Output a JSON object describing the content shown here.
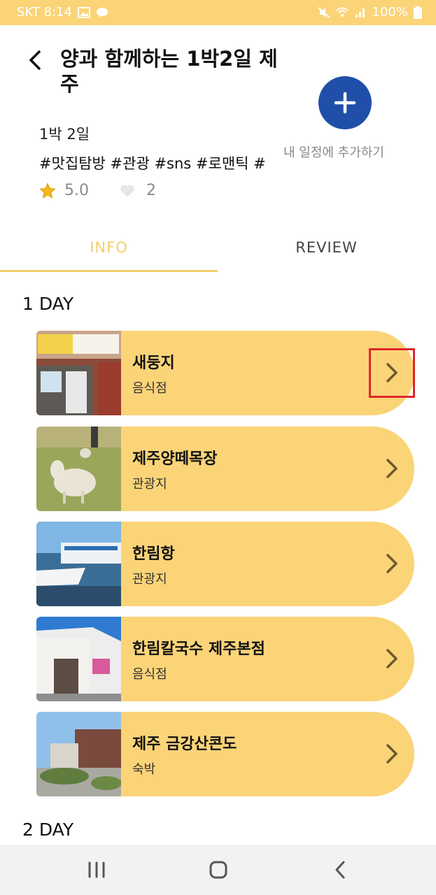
{
  "status_bar": {
    "carrier_time": "SKT 8:14",
    "battery": "100%"
  },
  "header": {
    "title": "양과 함께하는 1박2일 제주",
    "duration": "1박 2일",
    "tags": "#맛집탐방 #관광 #sns #로맨틱 #",
    "rating": "5.0",
    "likes": "2",
    "add_label": "내 일정에 추가하기"
  },
  "tabs": [
    {
      "label": "INFO",
      "active": true
    },
    {
      "label": "REVIEW",
      "active": false
    }
  ],
  "days": [
    {
      "label": "1 DAY",
      "places": [
        {
          "name": "새둥지",
          "category": "음식점"
        },
        {
          "name": "제주양떼목장",
          "category": "관광지"
        },
        {
          "name": "한림항",
          "category": "관광지"
        },
        {
          "name": "한림칼국수 제주본점",
          "category": "음식점"
        },
        {
          "name": "제주 금강산콘도",
          "category": "숙박"
        }
      ]
    },
    {
      "label": "2 DAY",
      "places": []
    }
  ],
  "colors": {
    "accent": "#fbd478",
    "tab_active": "#f4cd6c",
    "add_button": "#1f4fa8",
    "highlight": "#e0262a"
  }
}
